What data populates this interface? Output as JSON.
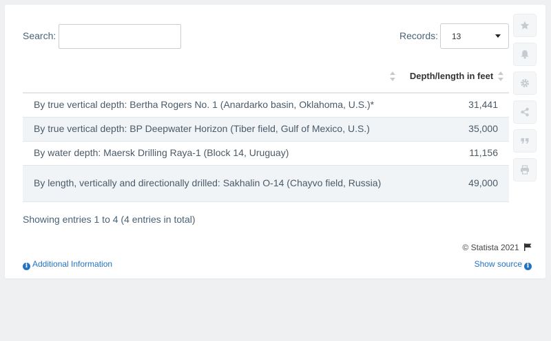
{
  "search": {
    "label": "Search:",
    "value": "",
    "placeholder": ""
  },
  "records": {
    "label": "Records:",
    "selected": "13"
  },
  "table": {
    "headers": [
      "",
      "Depth/length in feet"
    ],
    "rows": [
      {
        "name": "By true vertical depth: Bertha Rogers No. 1 (Anardarko basin, Oklahoma, U.S.)*",
        "value": "31,441"
      },
      {
        "name": "By true vertical depth: BP Deepwater Horizon (Tiber field, Gulf of Mexico, U.S.)",
        "value": "35,000"
      },
      {
        "name": "By water depth: Maersk Drilling Raya-1 (Block 14, Uruguay)",
        "value": "11,156"
      },
      {
        "name": "By length, vertically and directionally drilled: Sakhalin O-14 (Chayvo field, Russia)",
        "value": "49,000"
      }
    ]
  },
  "footer": {
    "showing": "Showing entries 1 to 4 (4 entries in total)",
    "copyright": "© Statista 2021",
    "additional_info": "Additional Information",
    "show_source": "Show source"
  },
  "sidebar": {
    "icons": [
      "star-icon",
      "bell-icon",
      "gear-icon",
      "share-icon",
      "quote-icon",
      "print-icon"
    ]
  },
  "colors": {
    "link": "#2372c4",
    "row_alt": "#f1f4f7",
    "icon": "#c5cbd1"
  }
}
